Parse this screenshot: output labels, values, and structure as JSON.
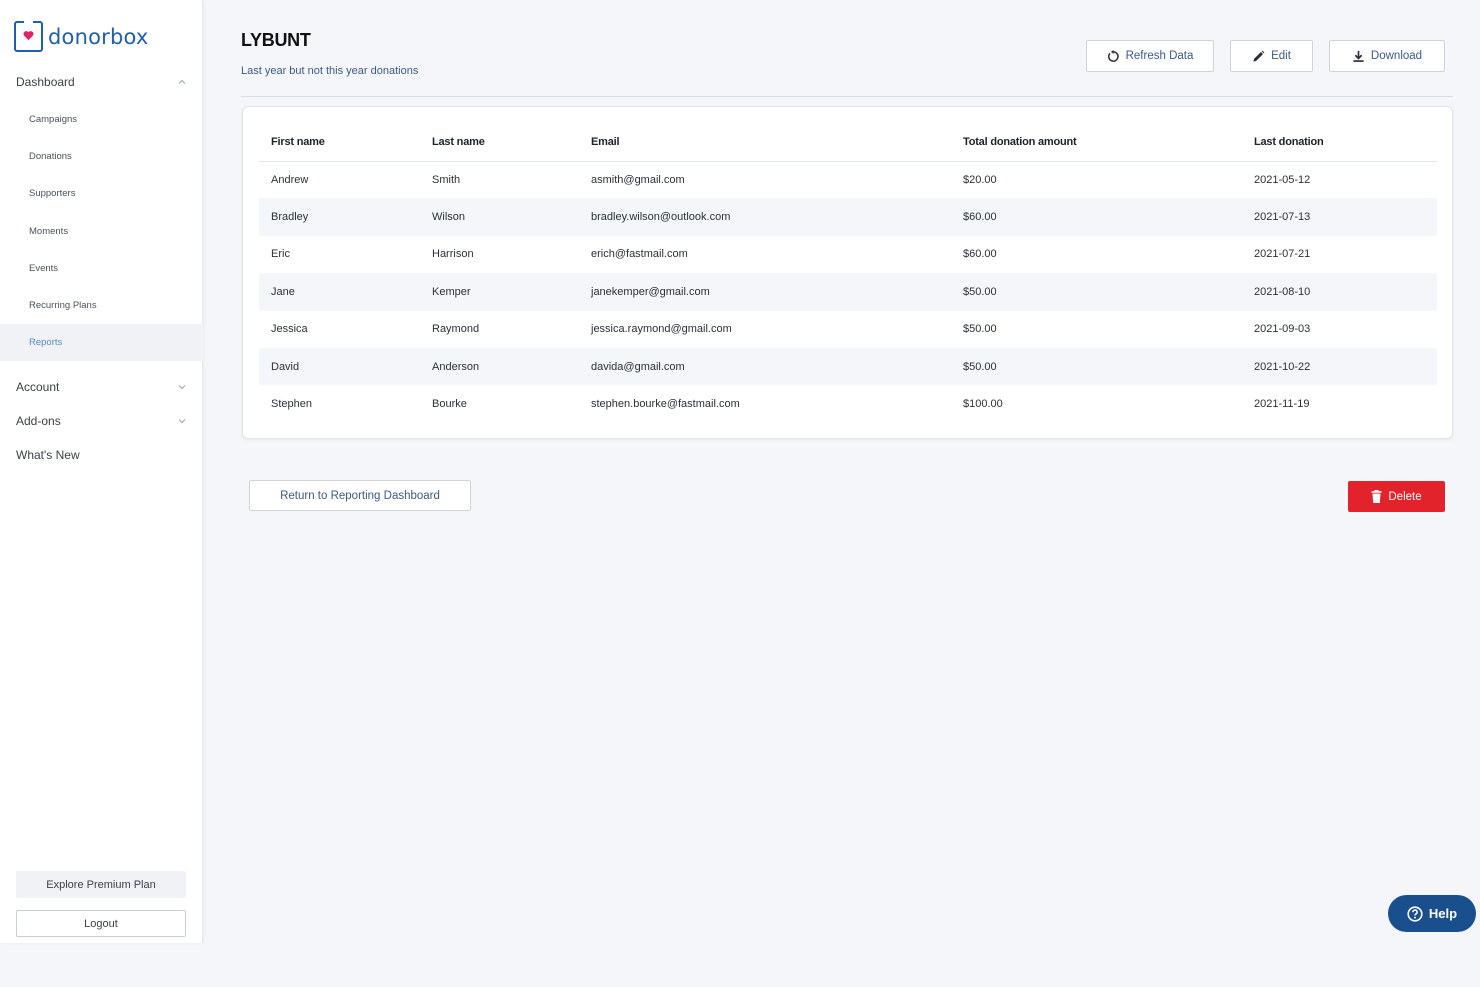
{
  "brand": {
    "name": "donorbox",
    "color": "#1f5fad"
  },
  "sidebar": {
    "sections": [
      {
        "label": "Dashboard",
        "chevron": "chevron-up-icon"
      },
      {
        "label": "Account",
        "chevron": "chevron-down-icon"
      },
      {
        "label": "Add-ons",
        "chevron": "chevron-down-icon"
      },
      {
        "label": "What's New"
      }
    ],
    "dashboard_items": [
      {
        "label": "Campaigns"
      },
      {
        "label": "Donations"
      },
      {
        "label": "Supporters"
      },
      {
        "label": "Moments"
      },
      {
        "label": "Events"
      },
      {
        "label": "Recurring Plans"
      },
      {
        "label": "Reports",
        "active": true
      }
    ],
    "premium_label": "Explore Premium Plan",
    "logout_label": "Logout"
  },
  "header": {
    "title": "LYBUNT",
    "subtitle": "Last year but not this year donations",
    "refresh_label": "Refresh Data",
    "edit_label": "Edit",
    "download_label": "Download"
  },
  "table": {
    "columns": [
      "First name",
      "Last name",
      "Email",
      "Total donation amount",
      "Last donation"
    ],
    "rows": [
      [
        "Andrew",
        "Smith",
        "asmith@gmail.com",
        "$20.00",
        "2021-05-12"
      ],
      [
        "Bradley",
        "Wilson",
        "bradley.wilson@outlook.com",
        "$60.00",
        "2021-07-13"
      ],
      [
        "Eric",
        "Harrison",
        "erich@fastmail.com",
        "$60.00",
        "2021-07-21"
      ],
      [
        "Jane",
        "Kemper",
        "janekemper@gmail.com",
        "$50.00",
        "2021-08-10"
      ],
      [
        "Jessica",
        "Raymond",
        "jessica.raymond@gmail.com",
        "$50.00",
        "2021-09-03"
      ],
      [
        "David",
        "Anderson",
        "davida@gmail.com",
        "$50.00",
        "2021-10-22"
      ],
      [
        "Stephen",
        "Bourke",
        "stephen.bourke@fastmail.com",
        "$100.00",
        "2021-11-19"
      ]
    ]
  },
  "actions": {
    "return_label": "Return to Reporting Dashboard",
    "delete_label": "Delete",
    "delete_color": "#e3232c"
  },
  "help": {
    "label": "Help",
    "color": "#1a4f8e"
  }
}
